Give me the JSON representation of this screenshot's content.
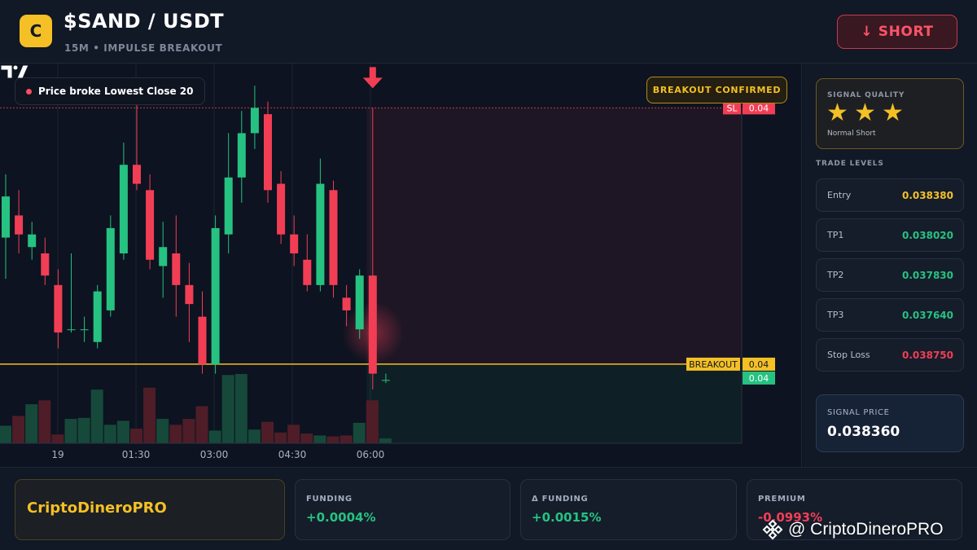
{
  "header": {
    "logo_letter": "C",
    "pair": "$SAND / USDT",
    "subtitle": "15M • IMPULSE BREAKOUT",
    "short_button": "↓ SHORT"
  },
  "chart": {
    "event_pill": "Price broke Lowest Close 20",
    "confirmed_pill": "BREAKOUT CONFIRMED",
    "short_marker": "SHORT",
    "sl_tag": "SL",
    "sl_value": "0.04",
    "breakout_tag": "BREAKOUT",
    "breakout_value": "0.04",
    "entry_value": "0.04",
    "time_labels": [
      "19",
      "01:30",
      "03:00",
      "04:30",
      "06:00"
    ],
    "colors": {
      "up": "#26c281",
      "down": "#f23e55",
      "breakout": "#f4c025"
    }
  },
  "chart_data": {
    "type": "candlestick",
    "series": [
      {
        "o": 0.03855,
        "h": 0.03875,
        "l": 0.03842,
        "c": 0.03868
      },
      {
        "o": 0.03862,
        "h": 0.0387,
        "l": 0.0385,
        "c": 0.03856
      },
      {
        "o": 0.03852,
        "h": 0.0386,
        "l": 0.03848,
        "c": 0.03856
      },
      {
        "o": 0.0385,
        "h": 0.03855,
        "l": 0.0384,
        "c": 0.03843
      },
      {
        "o": 0.0384,
        "h": 0.03845,
        "l": 0.0382,
        "c": 0.03825
      },
      {
        "o": 0.03826,
        "h": 0.0385,
        "l": 0.03825,
        "c": 0.03826
      },
      {
        "o": 0.03826,
        "h": 0.0383,
        "l": 0.03822,
        "c": 0.03826
      },
      {
        "o": 0.03822,
        "h": 0.0384,
        "l": 0.0382,
        "c": 0.03838
      },
      {
        "o": 0.03832,
        "h": 0.03862,
        "l": 0.0383,
        "c": 0.03858
      },
      {
        "o": 0.0385,
        "h": 0.03885,
        "l": 0.03848,
        "c": 0.03878
      },
      {
        "o": 0.03878,
        "h": 0.03903,
        "l": 0.0387,
        "c": 0.03872
      },
      {
        "o": 0.0387,
        "h": 0.03875,
        "l": 0.03845,
        "c": 0.03848
      },
      {
        "o": 0.03846,
        "h": 0.0386,
        "l": 0.03836,
        "c": 0.03852
      },
      {
        "o": 0.0385,
        "h": 0.03862,
        "l": 0.0383,
        "c": 0.0384
      },
      {
        "o": 0.0384,
        "h": 0.03847,
        "l": 0.03822,
        "c": 0.03834
      },
      {
        "o": 0.0383,
        "h": 0.03838,
        "l": 0.03812,
        "c": 0.03815
      },
      {
        "o": 0.03815,
        "h": 0.03862,
        "l": 0.03812,
        "c": 0.03858
      },
      {
        "o": 0.03856,
        "h": 0.03888,
        "l": 0.0385,
        "c": 0.03874
      },
      {
        "o": 0.03874,
        "h": 0.03895,
        "l": 0.03866,
        "c": 0.03888
      },
      {
        "o": 0.03888,
        "h": 0.03903,
        "l": 0.03883,
        "c": 0.03896
      },
      {
        "o": 0.03894,
        "h": 0.03898,
        "l": 0.03866,
        "c": 0.0387
      },
      {
        "o": 0.03872,
        "h": 0.03876,
        "l": 0.03853,
        "c": 0.03856
      },
      {
        "o": 0.03856,
        "h": 0.03862,
        "l": 0.03846,
        "c": 0.0385
      },
      {
        "o": 0.03848,
        "h": 0.03856,
        "l": 0.03838,
        "c": 0.0384
      },
      {
        "o": 0.0384,
        "h": 0.0388,
        "l": 0.03838,
        "c": 0.03872
      },
      {
        "o": 0.0387,
        "h": 0.03873,
        "l": 0.03836,
        "c": 0.0384
      },
      {
        "o": 0.03836,
        "h": 0.0384,
        "l": 0.03827,
        "c": 0.03832
      },
      {
        "o": 0.03826,
        "h": 0.03845,
        "l": 0.03823,
        "c": 0.03843
      },
      {
        "o": 0.03843,
        "h": 0.03896,
        "l": 0.03807,
        "c": 0.03812
      },
      {
        "o": 0.0381,
        "h": 0.03812,
        "l": 0.03809,
        "c": 0.0381
      }
    ],
    "volume": [
      18,
      28,
      40,
      44,
      9,
      25,
      26,
      55,
      19,
      23,
      15,
      57,
      25,
      19,
      25,
      38,
      13,
      70,
      71,
      14,
      22,
      11,
      19,
      10,
      8,
      7,
      8,
      21,
      44,
      5
    ],
    "levels": {
      "stop_loss": 0.03896,
      "breakout": 0.03815
    },
    "price_range": [
      0.0379,
      0.0391
    ]
  },
  "sidebar": {
    "quality_title": "SIGNAL QUALITY",
    "stars": [
      "★",
      "★",
      "★"
    ],
    "quality_label": "Normal Short",
    "levels_title": "TRADE LEVELS",
    "levels": [
      {
        "label": "Entry",
        "value": "0.038380",
        "color": "#f4c025"
      },
      {
        "label": "TP1",
        "value": "0.038020",
        "color": "#26c281"
      },
      {
        "label": "TP2",
        "value": "0.037830",
        "color": "#26c281"
      },
      {
        "label": "TP3",
        "value": "0.037640",
        "color": "#26c281"
      },
      {
        "label": "Stop Loss",
        "value": "0.038750",
        "color": "#f23e55"
      }
    ],
    "signal_price_title": "SIGNAL PRICE",
    "signal_price": "0.038360"
  },
  "footer": {
    "brand": "CriptoDineroPRO",
    "stats": [
      {
        "label": "FUNDING",
        "value": "+0.0004%",
        "color": "#26c281"
      },
      {
        "label": "Δ FUNDING",
        "value": "+0.0015%",
        "color": "#26c281"
      },
      {
        "label": "PREMIUM",
        "value": "-0.0993%",
        "color": "#f23e55"
      }
    ],
    "watermark": "@ CriptoDineroPRO"
  }
}
